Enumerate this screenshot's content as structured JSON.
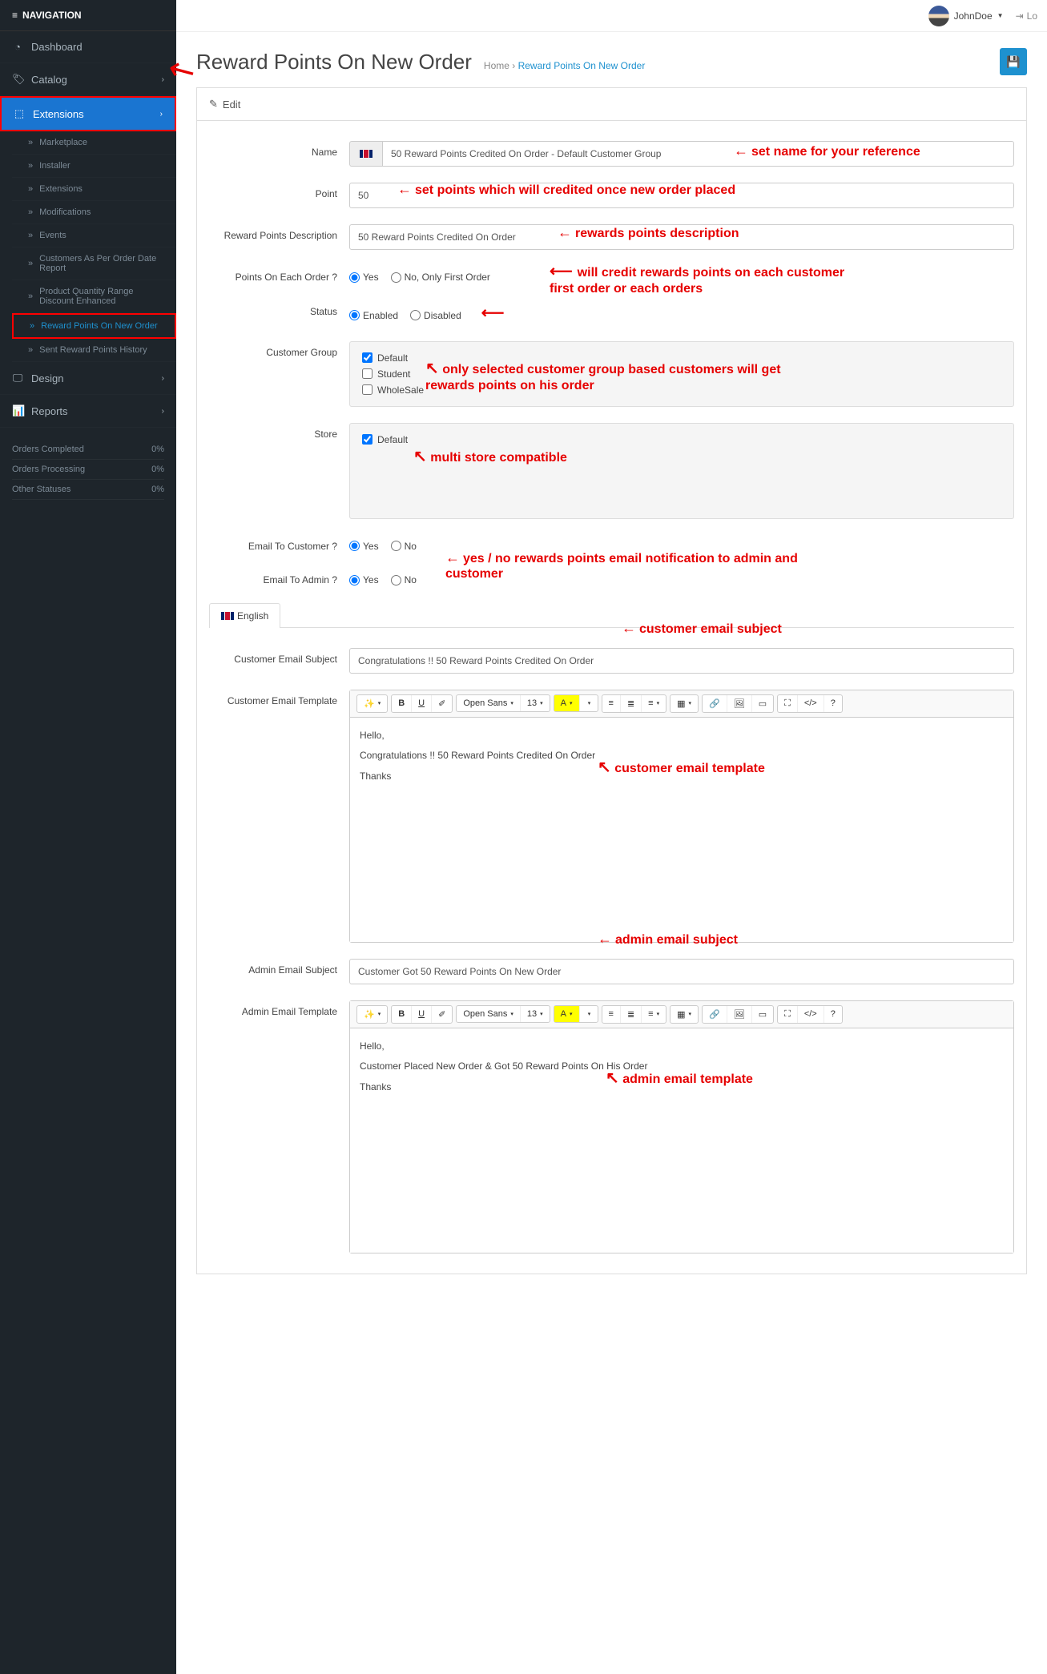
{
  "nav": {
    "header": "NAVIGATION",
    "items": {
      "dashboard": "Dashboard",
      "catalog": "Catalog",
      "extensions": "Extensions",
      "design": "Design",
      "reports": "Reports"
    },
    "sub_extensions": {
      "marketplace": "Marketplace",
      "installer": "Installer",
      "extensions": "Extensions",
      "modifications": "Modifications",
      "events": "Events",
      "customers_report": "Customers As Per Order Date Report",
      "product_qty": "Product Quantity Range Discount Enhanced",
      "reward_points": "Reward Points On New Order",
      "sent_history": "Sent Reward Points History"
    }
  },
  "stats": {
    "completed": {
      "label": "Orders Completed",
      "value": "0%"
    },
    "processing": {
      "label": "Orders Processing",
      "value": "0%"
    },
    "other": {
      "label": "Other Statuses",
      "value": "0%"
    }
  },
  "header": {
    "username": "JohnDoe",
    "logout": "Lo"
  },
  "page": {
    "title": "Reward Points On New Order",
    "breadcrumb_home": "Home",
    "breadcrumb_current": "Reward Points On New Order",
    "panel_title": "Edit"
  },
  "form": {
    "name_label": "Name",
    "name_value": "50 Reward Points Credited On Order - Default Customer Group",
    "point_label": "Point",
    "point_value": "50",
    "desc_label": "Reward Points Description",
    "desc_value": "50 Reward Points Credited On Order",
    "each_order_label": "Points On Each Order ?",
    "yes": "Yes",
    "no_only_first": "No, Only First Order",
    "no": "No",
    "status_label": "Status",
    "enabled": "Enabled",
    "disabled": "Disabled",
    "customer_group_label": "Customer Group",
    "groups": {
      "default": "Default",
      "student": "Student",
      "wholesale": "WholeSale"
    },
    "store_label": "Store",
    "store_default": "Default",
    "email_customer_label": "Email To Customer ?",
    "email_admin_label": "Email To Admin ?",
    "tab_english": "English",
    "cust_subject_label": "Customer Email Subject",
    "cust_subject_value": "Congratulations !! 50 Reward Points Credited On Order",
    "cust_template_label": "Customer Email Template",
    "cust_template_hello": "Hello,",
    "cust_template_body": "Congratulations !! 50 Reward Points Credited On Order",
    "cust_template_thanks": "Thanks",
    "admin_subject_label": "Admin Email Subject",
    "admin_subject_value": "Customer Got 50 Reward Points On New Order",
    "admin_template_label": "Admin Email Template",
    "admin_template_hello": "Hello,",
    "admin_template_body": "Customer Placed New Order & Got 50 Reward Points On His Order",
    "admin_template_thanks": "Thanks"
  },
  "toolbar": {
    "font": "Open Sans",
    "size": "13"
  },
  "annotations": {
    "name": "set name for your reference",
    "points": "set points which will credited once new order placed",
    "desc": "rewards points description",
    "each_order": "will credit rewards points on each customer first order or each orders",
    "customer_group": "only selected customer group based customers will get rewards points on his order",
    "store": "multi store compatible",
    "email": "yes / no rewards points email notification to admin and customer",
    "cust_subject": "customer email subject",
    "cust_template": "customer email template",
    "admin_subject": "admin email subject",
    "admin_template": "admin email template"
  }
}
